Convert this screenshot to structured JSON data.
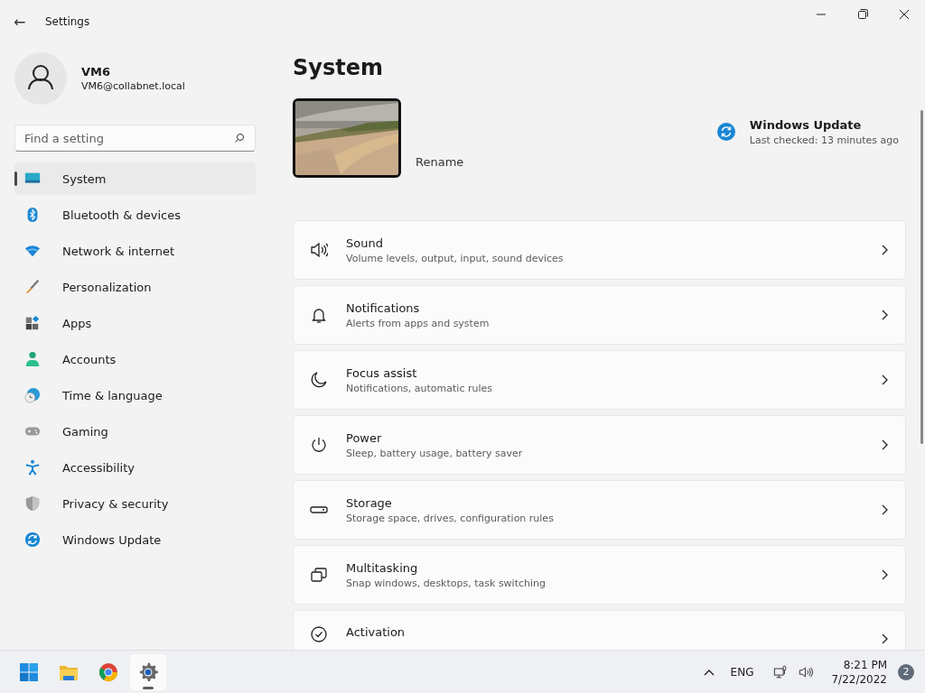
{
  "window": {
    "title": "Settings",
    "back": "←"
  },
  "user": {
    "name": "VM6",
    "email": "VM6@collabnet.local"
  },
  "search": {
    "placeholder": "Find a setting"
  },
  "nav": [
    {
      "label": "System",
      "selected": true
    },
    {
      "label": "Bluetooth & devices",
      "selected": false
    },
    {
      "label": "Network & internet",
      "selected": false
    },
    {
      "label": "Personalization",
      "selected": false
    },
    {
      "label": "Apps",
      "selected": false
    },
    {
      "label": "Accounts",
      "selected": false
    },
    {
      "label": "Time & language",
      "selected": false
    },
    {
      "label": "Gaming",
      "selected": false
    },
    {
      "label": "Accessibility",
      "selected": false
    },
    {
      "label": "Privacy & security",
      "selected": false
    },
    {
      "label": "Windows Update",
      "selected": false
    }
  ],
  "page": {
    "title": "System"
  },
  "device": {
    "rename": "Rename"
  },
  "update": {
    "title": "Windows Update",
    "status": "Last checked: 13 minutes ago"
  },
  "settings": [
    {
      "title": "Sound",
      "subtitle": "Volume levels, output, input, sound devices"
    },
    {
      "title": "Notifications",
      "subtitle": "Alerts from apps and system"
    },
    {
      "title": "Focus assist",
      "subtitle": "Notifications, automatic rules"
    },
    {
      "title": "Power",
      "subtitle": "Sleep, battery usage, battery saver"
    },
    {
      "title": "Storage",
      "subtitle": "Storage space, drives, configuration rules"
    },
    {
      "title": "Multitasking",
      "subtitle": "Snap windows, desktops, task switching"
    },
    {
      "title": "Activation"
    }
  ],
  "taskbar": {
    "apps": [
      {
        "active": false
      },
      {
        "active": false
      },
      {
        "active": false
      },
      {
        "active": true
      }
    ],
    "language": "ENG",
    "time": "8:21 PM",
    "date": "7/22/2022",
    "notifications": "2"
  }
}
